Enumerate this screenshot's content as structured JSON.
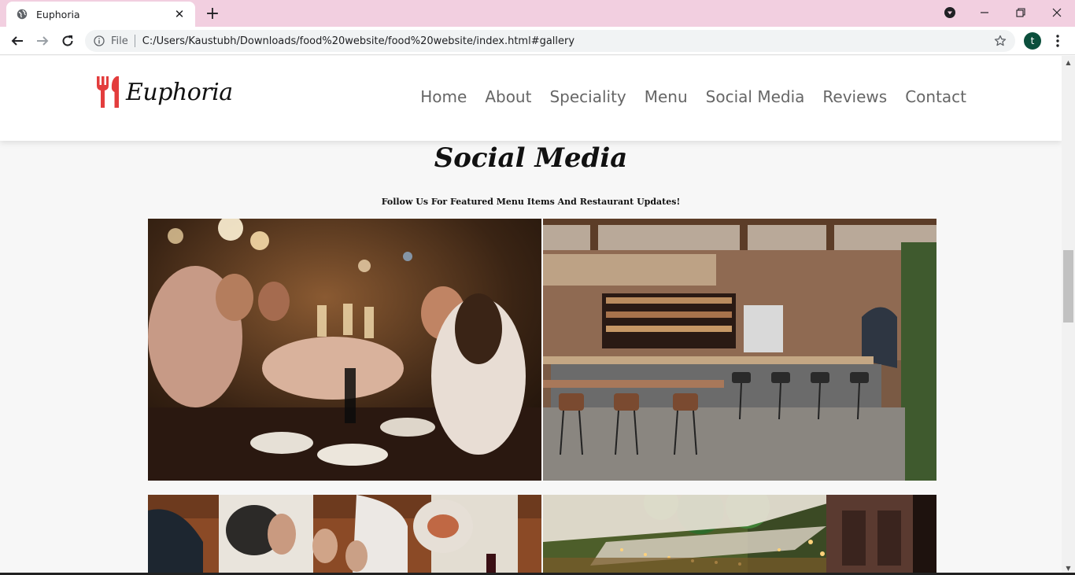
{
  "browser": {
    "tab_title": "Euphoria",
    "new_tab_symbol": "+",
    "close_symbol": "✕",
    "omnibox": {
      "scheme_label": "File",
      "url": "C:/Users/Kaustubh/Downloads/food%20website/food%20website/index.html#gallery"
    },
    "profile_initial": "t",
    "window_controls": {
      "minimize": "—",
      "restore": "❐",
      "close": "✕"
    },
    "theme_color": "#f2cfe0"
  },
  "site": {
    "brand": "Euphoria",
    "brand_color": "#e33d3d",
    "nav": [
      "Home",
      "About",
      "Speciality",
      "Menu",
      "Social Media",
      "Reviews",
      "Contact"
    ]
  },
  "gallery_section": {
    "title": "Social Media",
    "subtitle": "Follow Us For Featured Menu Items And Restaurant Updates!"
  },
  "icons": {
    "tab_favicon": "globe-icon",
    "back": "arrow-left-icon",
    "forward": "arrow-right-icon",
    "reload": "reload-icon",
    "info": "info-icon",
    "star": "star-icon",
    "menu": "more-vert-icon",
    "media": "media-control-icon"
  }
}
